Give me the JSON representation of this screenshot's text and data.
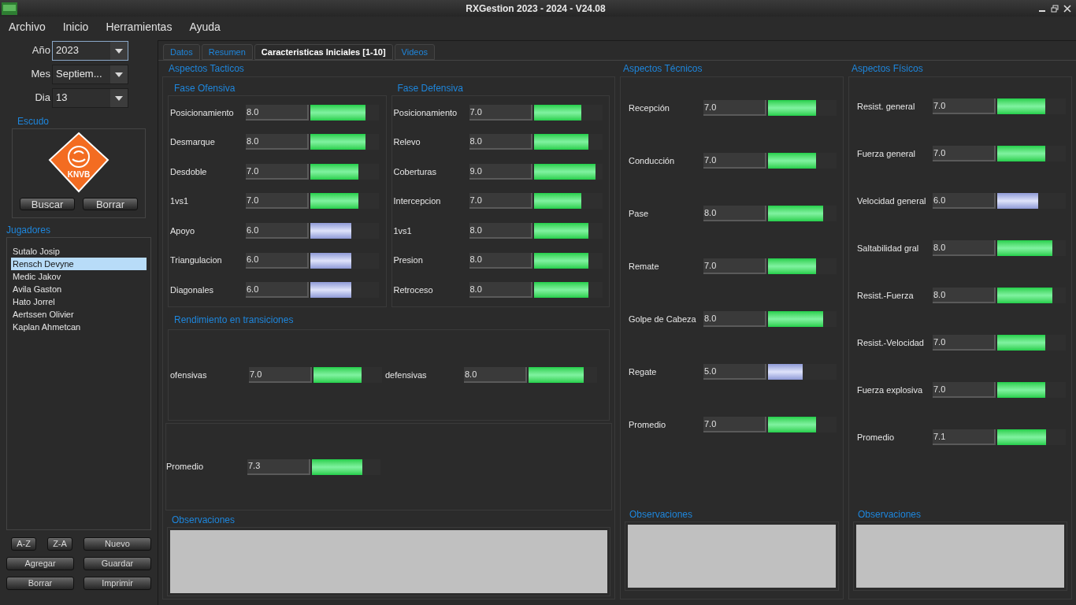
{
  "window": {
    "title": "RXGestion 2023 - 2024 - V24.08"
  },
  "menu": [
    "Archivo",
    "Inicio",
    "Herramientas",
    "Ayuda"
  ],
  "filters": [
    {
      "label": "Año",
      "value": "2023",
      "focused": true
    },
    {
      "label": "Mes",
      "value": "Septiem...",
      "focused": false
    },
    {
      "label": "Dia",
      "value": "13",
      "focused": false
    }
  ],
  "escudo": {
    "title": "Escudo",
    "logo_text": "KNVB",
    "buttons": [
      "Buscar",
      "Borrar"
    ]
  },
  "players": {
    "title": "Jugadores",
    "items": [
      {
        "name": "Sutalo Josip",
        "selected": false
      },
      {
        "name": "Rensch Devyne",
        "selected": true
      },
      {
        "name": "Medic Jakov",
        "selected": false
      },
      {
        "name": "Avila Gaston",
        "selected": false
      },
      {
        "name": "Hato Jorrel",
        "selected": false
      },
      {
        "name": "Aertssen Olivier",
        "selected": false
      },
      {
        "name": "Kaplan Ahmetcan",
        "selected": false
      }
    ]
  },
  "player_buttons": [
    [
      "A-Z",
      "Z-A",
      "Nuevo"
    ],
    [
      "Agregar",
      "Guardar"
    ],
    [
      "Borrar",
      "Imprimir"
    ]
  ],
  "tabs": [
    {
      "label": "Datos",
      "selected": false
    },
    {
      "label": "Resumen",
      "selected": false
    },
    {
      "label": "Caracteristicas Iniciales [1-10]",
      "selected": true
    },
    {
      "label": "Videos",
      "selected": false
    }
  ],
  "tacticos": {
    "title": "Aspectos Tacticos",
    "ofensiva": {
      "title": "Fase Ofensiva",
      "rows": [
        {
          "label": "Posicionamiento",
          "value": "8.0",
          "level": 0.8
        },
        {
          "label": "Desmarque",
          "value": "8.0",
          "level": 0.8
        },
        {
          "label": "Desdoble",
          "value": "7.0",
          "level": 0.7
        },
        {
          "label": "1vs1",
          "value": "7.0",
          "level": 0.7
        },
        {
          "label": "Apoyo",
          "value": "6.0",
          "level": 0.6
        },
        {
          "label": "Triangulacion",
          "value": "6.0",
          "level": 0.6
        },
        {
          "label": "Diagonales",
          "value": "6.0",
          "level": 0.6
        }
      ]
    },
    "defensiva": {
      "title": "Fase Defensiva",
      "rows": [
        {
          "label": "Posicionamiento",
          "value": "7.0",
          "level": 0.7
        },
        {
          "label": "Relevo",
          "value": "8.0",
          "level": 0.8
        },
        {
          "label": "Coberturas",
          "value": "9.0",
          "level": 0.9
        },
        {
          "label": "Intercepcion",
          "value": "7.0",
          "level": 0.7
        },
        {
          "label": "1vs1",
          "value": "8.0",
          "level": 0.8
        },
        {
          "label": "Presion",
          "value": "8.0",
          "level": 0.8
        },
        {
          "label": "Retroceso",
          "value": "8.0",
          "level": 0.8
        }
      ]
    },
    "transiciones": {
      "title": "Rendimiento en transiciones",
      "rows": [
        {
          "label": "ofensivas",
          "value": "7.0",
          "level": 0.7
        },
        {
          "label": "defensivas",
          "value": "8.0",
          "level": 0.8
        }
      ]
    },
    "promedio": {
      "label": "Promedio",
      "value": "7.3",
      "level": 0.73
    },
    "observaciones": "Observaciones"
  },
  "tecnicos": {
    "title": "Aspectos Técnicos",
    "rows": [
      {
        "label": "Recepción",
        "value": "7.0",
        "level": 0.7
      },
      {
        "label": "Conducción",
        "value": "7.0",
        "level": 0.7
      },
      {
        "label": "Pase",
        "value": "8.0",
        "level": 0.8
      },
      {
        "label": "Remate",
        "value": "7.0",
        "level": 0.7
      },
      {
        "label": "Golpe de Cabeza",
        "value": "8.0",
        "level": 0.8
      },
      {
        "label": "Regate",
        "value": "5.0",
        "level": 0.5
      },
      {
        "label": "Promedio",
        "value": "7.0",
        "level": 0.7
      }
    ],
    "observaciones": "Observaciones"
  },
  "fisicos": {
    "title": "Aspectos Físicos",
    "rows": [
      {
        "label": "Resist. general",
        "value": "7.0",
        "level": 0.7
      },
      {
        "label": "Fuerza general",
        "value": "7.0",
        "level": 0.7
      },
      {
        "label": "Velocidad general",
        "value": "6.0",
        "level": 0.6
      },
      {
        "label": "Saltabilidad gral",
        "value": "8.0",
        "level": 0.8
      },
      {
        "label": "Resist.-Fuerza",
        "value": "8.0",
        "level": 0.8
      },
      {
        "label": "Resist.-Velocidad",
        "value": "7.0",
        "level": 0.7
      },
      {
        "label": "Fuerza explosiva",
        "value": "7.0",
        "level": 0.7
      },
      {
        "label": "Promedio",
        "value": "7.1",
        "level": 0.71
      }
    ],
    "observaciones": "Observaciones"
  }
}
